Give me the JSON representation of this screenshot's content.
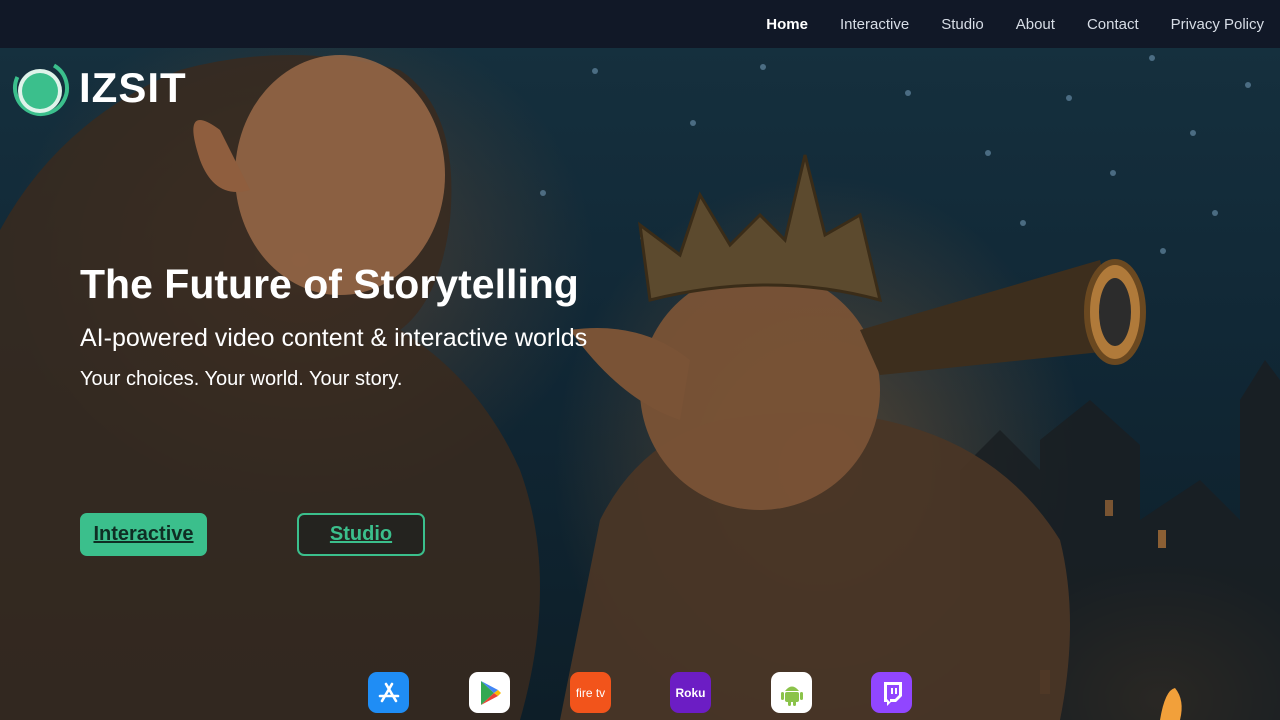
{
  "nav": {
    "items": [
      {
        "label": "Home",
        "active": true
      },
      {
        "label": "Interactive",
        "active": false
      },
      {
        "label": "Studio",
        "active": false
      },
      {
        "label": "About",
        "active": false
      },
      {
        "label": "Contact",
        "active": false
      },
      {
        "label": "Privacy Policy",
        "active": false
      }
    ]
  },
  "brand": {
    "name": "IZSIT",
    "accent": "#3bbf8c"
  },
  "hero": {
    "title": "The Future of Storytelling",
    "subtitle": "AI-powered video content & interactive worlds",
    "tagline": "Your choices. Your world. Your story.",
    "primary_button": "Interactive",
    "secondary_button": "Studio"
  },
  "stores": [
    {
      "icon": "app-store-icon",
      "color": "#1f8df5"
    },
    {
      "icon": "google-play-icon",
      "color": "#ffffff"
    },
    {
      "icon": "fire-tv-icon",
      "label": "fire tv",
      "color": "#f2541b"
    },
    {
      "icon": "roku-icon",
      "label": "Roku",
      "color": "#6c1dc4"
    },
    {
      "icon": "android-icon",
      "color": "#ffffff"
    },
    {
      "icon": "twitch-icon",
      "color": "#9146ff"
    }
  ]
}
